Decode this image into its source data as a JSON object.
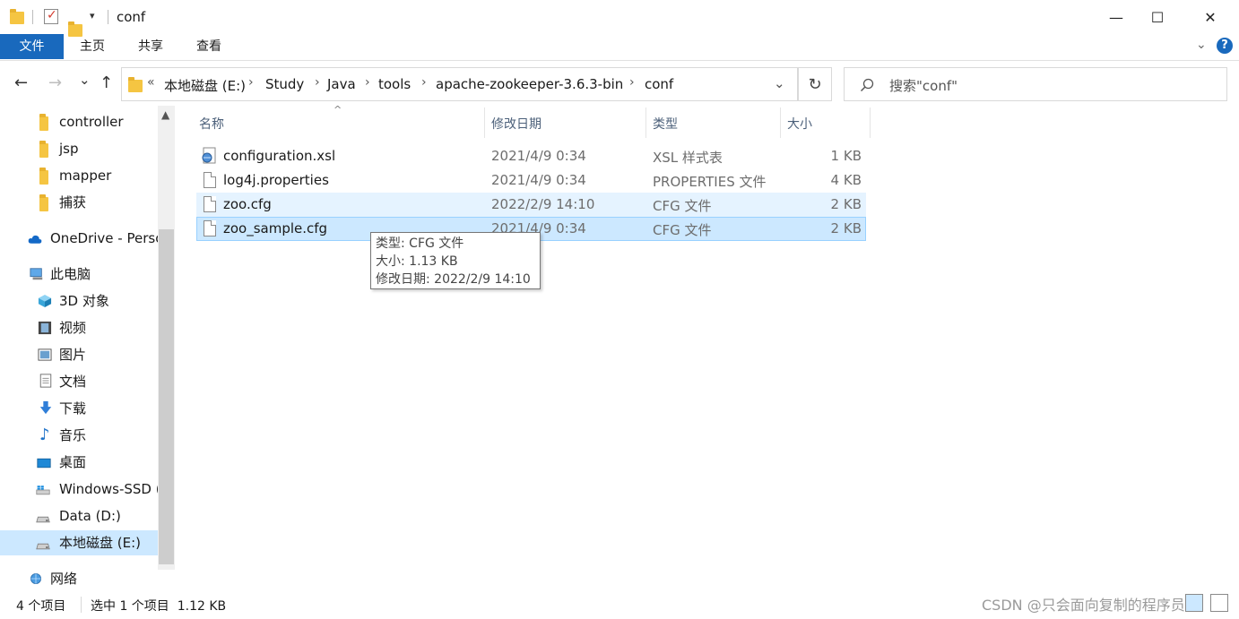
{
  "window": {
    "title": "conf",
    "minimize": "—",
    "maximize": "☐",
    "close": "✕"
  },
  "ribbon": {
    "tabs": [
      "文件",
      "主页",
      "共享",
      "查看"
    ]
  },
  "nav": {
    "back": "←",
    "forward": "→",
    "recent": "⌄",
    "up": "↑",
    "overflow": "«",
    "breadcrumbs": [
      "本地磁盘 (E:)",
      "Study",
      "Java",
      "tools",
      "apache-zookeeper-3.6.3-bin",
      "conf"
    ],
    "refresh": "↻",
    "search_placeholder": "搜索\"conf\""
  },
  "sidebar": {
    "items": [
      {
        "label": "controller",
        "icon": "folder-icon"
      },
      {
        "label": "jsp",
        "icon": "folder-icon"
      },
      {
        "label": "mapper",
        "icon": "folder-icon"
      },
      {
        "label": "捕获",
        "icon": "folder-icon"
      },
      {
        "label": "OneDrive - Perso",
        "icon": "cloud-icon"
      },
      {
        "label": "此电脑",
        "icon": "computer-icon"
      },
      {
        "label": "3D 对象",
        "icon": "cube-icon"
      },
      {
        "label": "视频",
        "icon": "video-icon"
      },
      {
        "label": "图片",
        "icon": "picture-icon"
      },
      {
        "label": "文档",
        "icon": "document-icon"
      },
      {
        "label": "下载",
        "icon": "download-icon"
      },
      {
        "label": "音乐",
        "icon": "music-icon"
      },
      {
        "label": "桌面",
        "icon": "desktop-icon"
      },
      {
        "label": "Windows-SSD (",
        "icon": "windows-drive-icon"
      },
      {
        "label": "Data (D:)",
        "icon": "drive-icon"
      },
      {
        "label": "本地磁盘 (E:)",
        "icon": "drive-icon"
      },
      {
        "label": "网络",
        "icon": "network-icon"
      }
    ]
  },
  "columns": [
    "名称",
    "修改日期",
    "类型",
    "大小"
  ],
  "files": [
    {
      "name": "configuration.xsl",
      "modified": "2021/4/9 0:34",
      "type": "XSL 样式表",
      "size": "1 KB"
    },
    {
      "name": "log4j.properties",
      "modified": "2021/4/9 0:34",
      "type": "PROPERTIES 文件",
      "size": "4 KB"
    },
    {
      "name": "zoo.cfg",
      "modified": "2022/2/9 14:10",
      "type": "CFG 文件",
      "size": "2 KB"
    },
    {
      "name": "zoo_sample.cfg",
      "modified": "2021/4/9 0:34",
      "type": "CFG 文件",
      "size": "2 KB"
    }
  ],
  "tooltip": {
    "line1": "类型: CFG 文件",
    "line2": "大小: 1.13 KB",
    "line3": "修改日期: 2022/2/9 14:10"
  },
  "status": {
    "count": "4 个项目",
    "selection": "选中 1 个项目  1.12 KB"
  },
  "watermark": "CSDN @只会面向复制的程序员",
  "colors": {
    "accent": "#1969bd",
    "selection": "#cce8ff",
    "hover": "#e5f3ff",
    "folder": "#f5c542"
  }
}
